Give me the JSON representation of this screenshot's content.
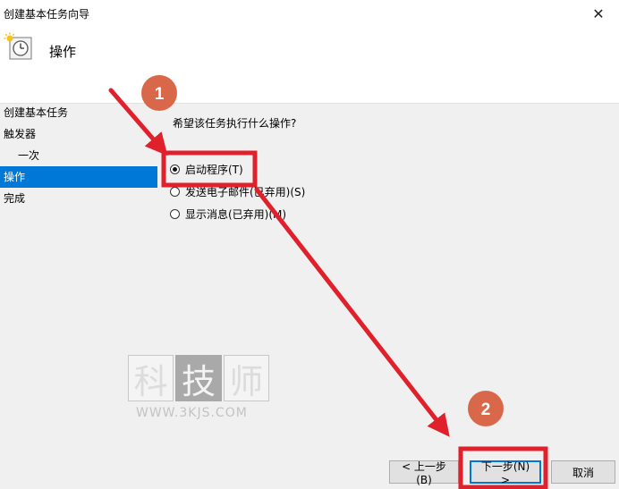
{
  "window": {
    "title": "创建基本任务向导",
    "close_glyph": "✕"
  },
  "header": {
    "section_title": "操作"
  },
  "sidebar": {
    "items": [
      {
        "label": "创建基本任务"
      },
      {
        "label": "触发器"
      },
      {
        "label": "一次"
      },
      {
        "label": "操作"
      },
      {
        "label": "完成"
      }
    ],
    "selected_index": 3
  },
  "main": {
    "question": "希望该任务执行什么操作?",
    "options": [
      {
        "label": "启动程序(T)",
        "checked": true
      },
      {
        "label": "发送电子邮件(已弃用)(S)",
        "checked": false
      },
      {
        "label": "显示消息(已弃用)(M)",
        "checked": false
      }
    ]
  },
  "footer": {
    "back_label": "< 上一步(B)",
    "next_label": "下一步(N) >",
    "cancel_label": "取消"
  },
  "watermark": {
    "chars": [
      "科",
      "技",
      "师"
    ],
    "url": "WWW.3KJS.COM"
  },
  "annotations": {
    "step1": "1",
    "step2": "2",
    "red": "#e0202a",
    "badge_fill": "#d9684a"
  },
  "colors": {
    "accent": "#0078d7",
    "header_bg": "#ffffff",
    "body_bg": "#f0f0f0",
    "button_bg": "#e1e1e1"
  },
  "icons": {
    "task": "task-clock-icon",
    "close": "close-icon"
  }
}
